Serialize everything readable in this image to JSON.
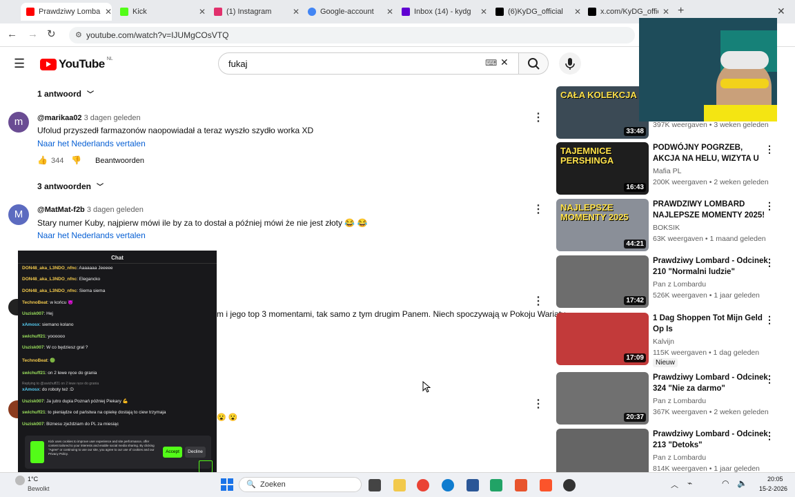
{
  "tabs": [
    {
      "label": "Prawdziwy Lombard",
      "color": "#ff0000"
    },
    {
      "label": "Kick",
      "color": "#53fc18"
    },
    {
      "label": "(1) Instagram",
      "color": "#e1306c"
    },
    {
      "label": "Google-account",
      "color": "#4285f4"
    },
    {
      "label": "Inbox (14) - kydg",
      "color": "#6001d2"
    },
    {
      "label": "(6)KyDG_official",
      "color": "#000000"
    },
    {
      "label": "x.com/KyDG_offici",
      "color": "#000000"
    }
  ],
  "address": {
    "url": "youtube.com/watch?v=IJUMgCOsVTQ"
  },
  "youtube": {
    "logo": "YouTube",
    "region": "NL",
    "search_value": "fukaj"
  },
  "comments": [
    {
      "replies_label": "1 antwoord",
      "author": "@marikaa02",
      "time": "3 dagen geleden",
      "avatar_letter": "m",
      "avatar_color": "#6a4c93",
      "text": "Ufolud przyszedł farmazonów naopowiadał a teraz wyszło szydło  worka XD",
      "translate": "Naar het Nederlands vertalen",
      "likes": "344",
      "reply_label": "Beantwoorden"
    },
    {
      "replies_label": "3 antwoorden",
      "author": "@MatMat-f2b",
      "time": "3 dagen geleden",
      "avatar_letter": "M",
      "avatar_color": "#5c6bc0",
      "text": "Stary numer Kuby, najpierw mówi ile by za to dostał a później mówi że nie jest złoty 😂 😂",
      "translate": "Naar het Nederlands vertalen"
    }
  ],
  "partial_comment_text": "m i jego top 3 momentami, tak samo z tym drugim Panem. Niech spoczywają w Pokoju Wariaty",
  "partial_emoji": "😮 😮",
  "sidebar": [
    {
      "title": "",
      "channel": "",
      "stats": "397K weergaven • 3 weken geleden",
      "duration": "33:48",
      "thumb_text": "CAŁA KOLEKCJA",
      "bg": "#3b4a55"
    },
    {
      "title": "PODWÓJNY POGRZEB, AKCJA NA HELU, WIZYTA U ART-B I ...",
      "channel": "Mafia PL",
      "stats": "200K weergaven • 2 weken geleden",
      "duration": "16:43",
      "thumb_text": "TAJEMNICE PERSHINGA",
      "bg": "#1e1e1e"
    },
    {
      "title": "PRAWDZIWY LOMBARD NAJLEPSZE MOMENTY 2025!",
      "channel": "BOKSIK",
      "stats": "63K weergaven • 1 maand geleden",
      "duration": "44:21",
      "thumb_text": "NAJLEPSZE MOMENTY 2025",
      "bg": "#8a8f98"
    },
    {
      "title": "Prawdziwy Lombard - Odcinek 210 \"Normalni ludzie\"",
      "channel": "Pan z Lombardu",
      "stats": "526K weergaven • 1 jaar geleden",
      "duration": "17:42",
      "thumb_text": "",
      "bg": "#6d6d6d"
    },
    {
      "title": "1 Dag Shoppen Tot Mijn Geld Op Is",
      "channel": "Kalvijn",
      "stats": "115K weergaven • 1 dag geleden",
      "duration": "17:09",
      "thumb_text": "",
      "bg": "#c23a3a",
      "badge": "Nieuw"
    },
    {
      "title": "Prawdziwy Lombard - Odcinek 324 \"Nie za darmo\"",
      "channel": "Pan z Lombardu",
      "stats": "367K weergaven • 2 weken geleden",
      "duration": "20:37",
      "thumb_text": "",
      "bg": "#707070"
    },
    {
      "title": "Prawdziwy Lombard - Odcinek 213 \"Detoks\"",
      "channel": "Pan z Lombardu",
      "stats": "814K weergaven • 1 jaar geleden",
      "duration": "",
      "thumb_text": "",
      "bg": "#656565"
    }
  ],
  "chat": {
    "title": "Chat",
    "messages": [
      {
        "user": "DON48_aka_L3NDO_nfnc",
        "text": "Aaaaaaa Jeeeee",
        "color": "#f2c94c"
      },
      {
        "user": "DON48_aka_L3NDO_nfnc",
        "text": "Elegancko",
        "color": "#f2c94c"
      },
      {
        "user": "DON48_aka_L3NDO_nfnc",
        "text": "Siema siema",
        "color": "#f2c94c"
      },
      {
        "user": "TechnoBeat",
        "text": "w końcu 😈",
        "color": "#f2c94c"
      },
      {
        "user": "Uszisk007",
        "text": "Hej",
        "color": "#9be15d"
      },
      {
        "user": "xAmosx",
        "text": "siemano kolano",
        "color": "#56ccf2"
      },
      {
        "user": "swichuff21",
        "text": "yoooooo",
        "color": "#9be15d"
      },
      {
        "user": "Uszisk007",
        "text": "W co będziesz grał ?",
        "color": "#9be15d"
      },
      {
        "user": "TechnoBeat",
        "text": "🟢",
        "color": "#f2c94c"
      },
      {
        "user": "swichuff21",
        "text": "on 2 lewe ręce do grania",
        "color": "#9be15d"
      },
      {
        "user": "xAmosx",
        "text": "do roboty też :D",
        "color": "#56ccf2"
      },
      {
        "user": "Uszisk007",
        "text": "Ja jutro dupia Poznań później Piekary 💪",
        "color": "#9be15d"
      },
      {
        "user": "swichuff21",
        "text": "to pieniądze od państwa na opiekę dostają to ciew trzymaja",
        "color": "#9be15d"
      },
      {
        "user": "Uszisk007",
        "text": "Biznesu zjeździam do PL za miesiąc",
        "color": "#9be15d"
      }
    ],
    "reply_hint": "Replying to @swichuff21 on 2 lewe ręce do grania",
    "cookie_text": "Kick uses cookies to improve user experience and site performance, offer content tailored to your interests and enable social media sharing. By clicking \"Agree\" or continuing to use our site, you agree to our use of cookies and our Privacy Policy.",
    "accept": "Accept",
    "decline": "Decline"
  },
  "taskbar": {
    "weather_temp": "1°C",
    "weather_desc": "Bewolkt",
    "search_placeholder": "Zoeken",
    "time": "20:05",
    "date": "15-2-2026"
  }
}
